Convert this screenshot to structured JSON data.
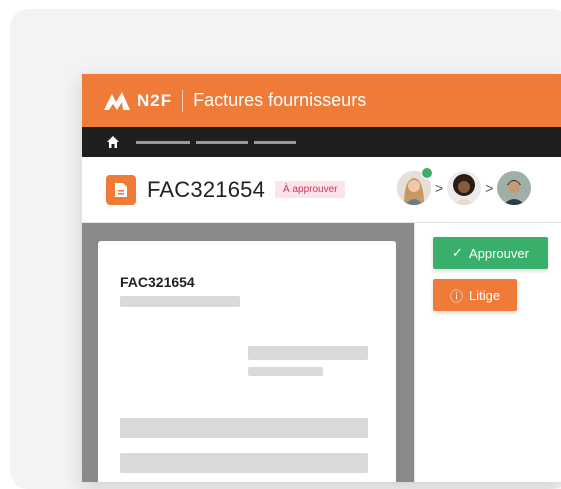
{
  "header": {
    "brand": "N2F",
    "title": "Factures fournisseurs",
    "colors": {
      "brand": "#f07a37",
      "nav": "#1f1f1f"
    }
  },
  "nav": {
    "icon": "home-icon"
  },
  "invoice": {
    "id": "FAC321654",
    "status": "À approuver",
    "approvers_chevron": ">"
  },
  "document": {
    "id": "FAC321654"
  },
  "actions": {
    "approve_label": "Approuver",
    "approve_icon": "✓",
    "dispute_label": "Litige",
    "dispute_icon": "ⓘ",
    "colors": {
      "approve": "#3aaf6b",
      "dispute": "#f07a37"
    }
  }
}
